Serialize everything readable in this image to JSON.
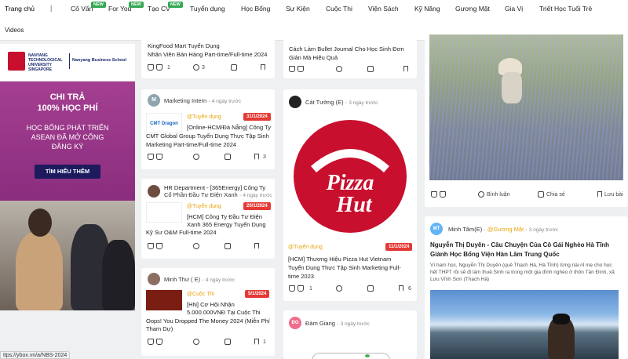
{
  "nav": {
    "items": [
      "Trang chủ",
      "Cố Vấn",
      "For You",
      "Tạo CV",
      "Tuyển dụng",
      "Học Bổng",
      "Sự Kiện",
      "Cuộc Thi",
      "Viện Sách",
      "Kỹ Năng",
      "Gương Mặt",
      "Gia Vị",
      "Triết Học Tuổi Trẻ"
    ],
    "separator": "|",
    "new_badge": "NEW",
    "second_row": "Videos"
  },
  "ad": {
    "university": "NANYANG TECHNOLOGICAL UNIVERSITY SINGAPORE",
    "school": "Nanyang Business School",
    "headline1": "CHI TRẢ",
    "headline2": "100% HỌC PHÍ",
    "body1": "HỌC BỔNG PHÁT TRIỂN",
    "body2": "ASEAN ĐÃ MỞ CỔNG",
    "body3": "ĐĂNG KÝ",
    "cta": "TÌM HIỂU THÊM"
  },
  "status_url": "ttps://ybox.vn/a/NBS-2024",
  "col1": {
    "top_title1": "KingFood Mart Tuyển Dụng",
    "top_title2": "Nhân Viên Bán Hàng Part-time/Full-time 2024",
    "top_likes": "1",
    "top_comments": "3",
    "card1": {
      "author": "Marketing Intern",
      "avatar": "M",
      "time": "4 ngày trước",
      "tag": "@Tuyển dụng",
      "date": "31/1/2024",
      "logo": "CMT Dragon",
      "title1": "[Online-HCM/Đà Nẵng] Công Ty",
      "title2": "CMT Global Group Tuyển Dụng Thực Tập Sinh",
      "title3": "Marketing Part-time/Full-time 2024",
      "saves": "3"
    },
    "card2": {
      "author1": "HR Department - [365Energy] Công Ty",
      "author2": "Cổ Phần Đầu Tư Điện Xanh",
      "time": "4 ngày trước",
      "tag": "@Tuyển dụng",
      "date": "20/1/2024",
      "title1": "[HCM] Công Ty Đầu Tư Điện",
      "title2": "Xanh 365 Energy Tuyển Dụng",
      "title3": "Kỹ Sư O&M Full-time 2024"
    },
    "card3": {
      "author": "Minh Thư ( E)",
      "time": "4 ngày trước",
      "tag": "@Cuộc Thi",
      "date": "5/1/2024",
      "title1": "[HN] Cơ Hội Nhận",
      "title2": "5.000.000VNĐ Tại Cuộc Thi",
      "title3": "Oops! You Dropped The Money 2024 (Miễn Phí",
      "title4": "Tham Dự)",
      "saves": "1"
    }
  },
  "col2": {
    "top_title1": "Cách Làm Bullet Journal Cho Học Sinh Đơn",
    "top_title2": "Giản Mà Hiệu Quả",
    "card1": {
      "author": "Cát Tường (E)",
      "time": "3 ngày trước",
      "brand1": "Pizza",
      "brand2": "Hut",
      "tag": "@Tuyển dụng",
      "date": "11/1/2024",
      "title1": "[HCM] Thương Hiệu Pizza Hut Vietnam",
      "title2": "Tuyển Dụng Thực Tập Sinh Marketing Full-",
      "title3": "time 2023",
      "likes": "1",
      "saves": "6"
    },
    "card2": {
      "author": "Đàm Giang",
      "avatar": "ĐG",
      "time": "3 ngày trước"
    }
  },
  "col3": {
    "card1": {
      "comment_label": "Bình luận",
      "share_label": "Chia sẻ",
      "save_label": "Lưu bài"
    },
    "card2": {
      "author": "Minh Tâm(E)",
      "avatar": "MT",
      "tag": "@Gương Mặt",
      "time": "3 ngày trước",
      "title1": "Nguyễn Thị Duyên - Câu Chuyện Của Cô Gái Nghèo Hà Tĩnh",
      "title2": "Giành Học Bổng Viện Hàn Lâm Trung Quốc",
      "excerpt1": "Vì ham học, Nguyễn Thị Duyên (quê Thạch Hà, Hà Tĩnh) từng nài nỉ mẹ cho học",
      "excerpt2": "hết THPT rồi sẽ đi làm thuê.Sinh ra trong một gia đình nghèo ở thôn Tân Đình, xã",
      "excerpt3": "Lưu Vĩnh Sơn (Thạch Hà)"
    }
  },
  "colors": {
    "accent": "#e8a40c",
    "date_badge": "#e53935",
    "new_badge": "#34a853",
    "pizza_red": "#c8102e"
  }
}
